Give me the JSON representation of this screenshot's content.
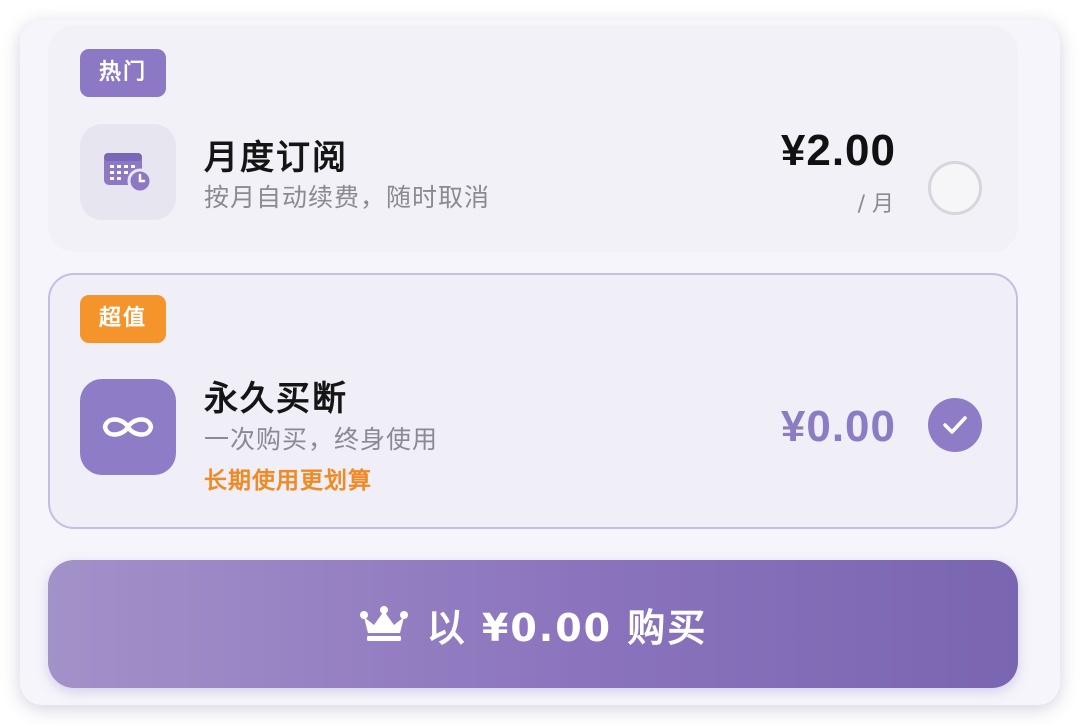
{
  "plans": [
    {
      "tag": "热门",
      "icon": "calendar-clock-icon",
      "title": "月度订阅",
      "description": "按月自动续费，随时取消",
      "price": "¥2.00",
      "unit": "/ 月",
      "selected": false
    },
    {
      "tag": "超值",
      "icon": "infinity-icon",
      "title": "永久买断",
      "description": "一次购买，终身使用",
      "note": "长期使用更划算",
      "price": "¥0.00",
      "selected": true
    }
  ],
  "buy_button": {
    "icon": "crown-icon",
    "label": "以 ¥0.00 购买"
  },
  "colors": {
    "accent": "#8f7cc7",
    "tag_hot": "#8c78c5",
    "tag_value": "#f4942a",
    "note": "#ef8a25"
  }
}
